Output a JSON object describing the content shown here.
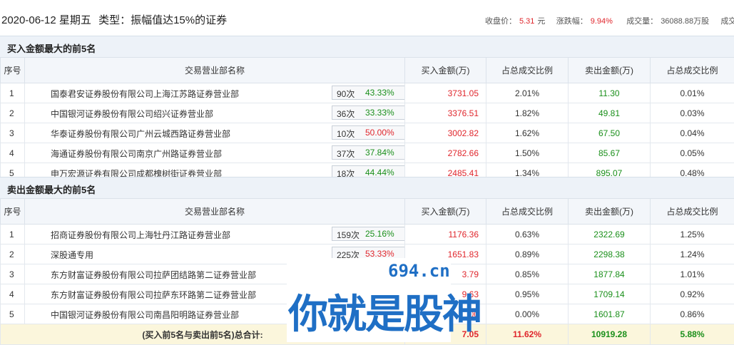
{
  "header": {
    "date": "2020-06-12 星期五",
    "type_text": "类型：振幅值达15%的证券",
    "close_label": "收盘价：",
    "close_value": "5.31",
    "close_unit": "元",
    "change_label": "涨跌幅：",
    "change_value": "9.94%",
    "volume_label": "成交量：",
    "volume_value": "36088.88万股",
    "turnover_label": "成交"
  },
  "buy_section": {
    "title": "买入金额最大的前5名",
    "columns": [
      "序号",
      "交易营业部名称",
      "买入金额(万)",
      "占总成交比例",
      "卖出金额(万)",
      "占总成交比例"
    ],
    "rows": [
      {
        "idx": "1",
        "name": "国泰君安证券股份有限公司上海江苏路证券营业部",
        "times": "90次",
        "pct": "43.33%",
        "buy": "3731.05",
        "buy_ratio": "2.01%",
        "sell": "11.30",
        "sell_ratio": "0.01%",
        "badge": "?"
      },
      {
        "idx": "2",
        "name": "中国银河证券股份有限公司绍兴证券营业部",
        "times": "36次",
        "pct": "33.33%",
        "buy": "3376.51",
        "buy_ratio": "1.82%",
        "sell": "49.81",
        "sell_ratio": "0.03%"
      },
      {
        "idx": "3",
        "name": "华泰证券股份有限公司广州云城西路证券营业部",
        "times": "10次",
        "pct": "50.00%",
        "buy": "3002.82",
        "buy_ratio": "1.62%",
        "sell": "67.50",
        "sell_ratio": "0.04%"
      },
      {
        "idx": "4",
        "name": "海通证券股份有限公司南京广州路证券营业部",
        "times": "37次",
        "pct": "37.84%",
        "buy": "2782.66",
        "buy_ratio": "1.50%",
        "sell": "85.67",
        "sell_ratio": "0.05%"
      },
      {
        "idx": "5",
        "name": "申万宏源证券有限公司成都槐树街证券营业部",
        "times": "18次",
        "pct": "44.44%",
        "buy": "2485.41",
        "buy_ratio": "1.34%",
        "sell": "895.07",
        "sell_ratio": "0.48%"
      }
    ]
  },
  "sell_section": {
    "title": "卖出金额最大的前5名",
    "columns": [
      "序号",
      "交易营业部名称",
      "买入金额(万)",
      "占总成交比例",
      "卖出金额(万)",
      "占总成交比例"
    ],
    "rows": [
      {
        "idx": "1",
        "name": "招商证券股份有限公司上海牡丹江路证券营业部",
        "times": "159次",
        "pct": "25.16%",
        "buy": "1176.36",
        "buy_ratio": "0.63%",
        "sell": "2322.69",
        "sell_ratio": "1.25%"
      },
      {
        "idx": "2",
        "name": "深股通专用",
        "times": "225次",
        "pct": "53.33%",
        "buy": "1651.83",
        "buy_ratio": "0.89%",
        "sell": "2298.38",
        "sell_ratio": "1.24%"
      },
      {
        "idx": "3",
        "name": "东方财富证券股份有限公司拉萨团结路第二证券营业部",
        "times": "",
        "pct": "",
        "buy": "3.79",
        "buy_ratio": "0.85%",
        "sell": "1877.84",
        "sell_ratio": "1.01%"
      },
      {
        "idx": "4",
        "name": "东方财富证券股份有限公司拉萨东环路第二证券营业部",
        "times": "",
        "pct": "",
        "buy": "9.63",
        "buy_ratio": "0.95%",
        "sell": "1709.14",
        "sell_ratio": "0.92%"
      },
      {
        "idx": "5",
        "name": "中国银河证券股份有限公司南昌阳明路证券营业部",
        "times": "",
        "pct": "",
        "buy": "00",
        "buy_ratio": "0.00%",
        "sell": "1601.87",
        "sell_ratio": "0.86%"
      }
    ],
    "total": {
      "label": "(买入前5名与卖出前5名)总合计:",
      "buy": "7.05",
      "buy_ratio": "11.62%",
      "sell": "10919.28",
      "sell_ratio": "5.88%"
    }
  },
  "watermark": {
    "domain": "694.cn",
    "slogan": "你就是股神"
  },
  "colors": {
    "up": "#e0262c",
    "green": "#1a8f1a",
    "header_bg": "#edf2f8",
    "total_bg": "#fbf6dc"
  }
}
